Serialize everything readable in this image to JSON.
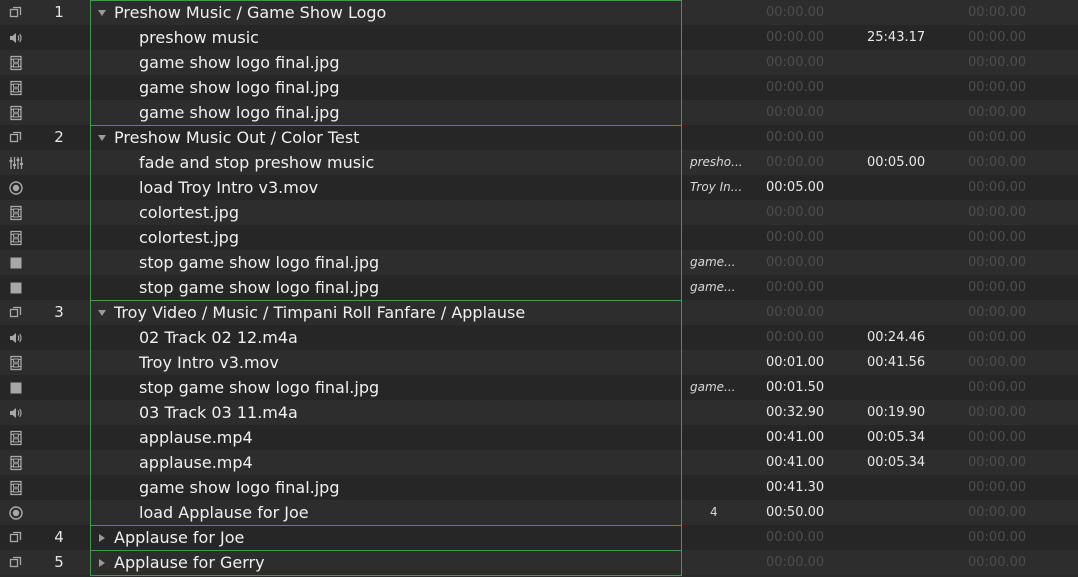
{
  "cues": [
    {
      "type": "group",
      "number": "1",
      "name": "Preshow Music / Game Show Logo",
      "target": "",
      "pre_wait": "00:00.00",
      "action": "",
      "post_wait": "00:00.00",
      "expanded": true,
      "depth": 0,
      "dims": {
        "pre": true,
        "post": true
      }
    },
    {
      "type": "audio",
      "number": "",
      "name": "preshow music",
      "target": "",
      "pre_wait": "00:00.00",
      "action": "25:43.17",
      "post_wait": "00:00.00",
      "depth": 1,
      "dims": {
        "pre": true,
        "post": true
      }
    },
    {
      "type": "video",
      "number": "",
      "name": "game show logo final.jpg",
      "target": "",
      "pre_wait": "00:00.00",
      "action": "",
      "post_wait": "00:00.00",
      "depth": 1,
      "dims": {
        "pre": true,
        "post": true
      }
    },
    {
      "type": "video",
      "number": "",
      "name": "game show logo final.jpg",
      "target": "",
      "pre_wait": "00:00.00",
      "action": "",
      "post_wait": "00:00.00",
      "depth": 1,
      "dims": {
        "pre": true,
        "post": true
      }
    },
    {
      "type": "video",
      "number": "",
      "name": "game show logo final.jpg",
      "target": "",
      "pre_wait": "00:00.00",
      "action": "",
      "post_wait": "00:00.00",
      "depth": 1,
      "dims": {
        "pre": true,
        "post": true
      }
    },
    {
      "type": "group",
      "number": "2",
      "name": "Preshow Music Out / Color Test",
      "target": "",
      "pre_wait": "00:00.00",
      "action": "",
      "post_wait": "00:00.00",
      "expanded": true,
      "depth": 0,
      "dims": {
        "pre": true,
        "post": true
      }
    },
    {
      "type": "fade",
      "number": "",
      "name": "fade and stop preshow music",
      "target": "presho...",
      "pre_wait": "00:00.00",
      "action": "00:05.00",
      "post_wait": "00:00.00",
      "depth": 1,
      "dims": {
        "pre": true,
        "post": true
      }
    },
    {
      "type": "load",
      "number": "",
      "name": "load Troy Intro v3.mov",
      "target": "Troy In...",
      "pre_wait": "00:05.00",
      "action": "",
      "post_wait": "00:00.00",
      "depth": 1,
      "dims": {
        "pre": false,
        "post": true
      }
    },
    {
      "type": "video",
      "number": "",
      "name": "colortest.jpg",
      "target": "",
      "pre_wait": "00:00.00",
      "action": "",
      "post_wait": "00:00.00",
      "depth": 1,
      "dims": {
        "pre": true,
        "post": true
      }
    },
    {
      "type": "video",
      "number": "",
      "name": "colortest.jpg",
      "target": "",
      "pre_wait": "00:00.00",
      "action": "",
      "post_wait": "00:00.00",
      "depth": 1,
      "dims": {
        "pre": true,
        "post": true
      }
    },
    {
      "type": "stop",
      "number": "",
      "name": "stop game show logo final.jpg",
      "target": "game...",
      "pre_wait": "00:00.00",
      "action": "",
      "post_wait": "00:00.00",
      "depth": 1,
      "dims": {
        "pre": true,
        "post": true
      }
    },
    {
      "type": "stop",
      "number": "",
      "name": "stop game show logo final.jpg",
      "target": "game...",
      "pre_wait": "00:00.00",
      "action": "",
      "post_wait": "00:00.00",
      "depth": 1,
      "dims": {
        "pre": true,
        "post": true
      }
    },
    {
      "type": "group",
      "number": "3",
      "name": "Troy Video / Music / Timpani Roll Fanfare / Applause",
      "target": "",
      "pre_wait": "00:00.00",
      "action": "",
      "post_wait": "00:00.00",
      "expanded": true,
      "depth": 0,
      "dims": {
        "pre": true,
        "post": true
      }
    },
    {
      "type": "audio",
      "number": "",
      "name": "02 Track 02 12.m4a",
      "target": "",
      "pre_wait": "00:00.00",
      "action": "00:24.46",
      "post_wait": "00:00.00",
      "depth": 1,
      "dims": {
        "pre": true,
        "post": true
      }
    },
    {
      "type": "video",
      "number": "",
      "name": "Troy Intro v3.mov",
      "target": "",
      "pre_wait": "00:01.00",
      "action": "00:41.56",
      "post_wait": "00:00.00",
      "depth": 1,
      "dims": {
        "pre": false,
        "post": true
      }
    },
    {
      "type": "stop",
      "number": "",
      "name": "stop game show logo final.jpg",
      "target": "game...",
      "pre_wait": "00:01.50",
      "action": "",
      "post_wait": "00:00.00",
      "depth": 1,
      "dims": {
        "pre": false,
        "post": true
      }
    },
    {
      "type": "audio",
      "number": "",
      "name": "03 Track 03 11.m4a",
      "target": "",
      "pre_wait": "00:32.90",
      "action": "00:19.90",
      "post_wait": "00:00.00",
      "depth": 1,
      "dims": {
        "pre": false,
        "post": true
      }
    },
    {
      "type": "video",
      "number": "",
      "name": "applause.mp4",
      "target": "",
      "pre_wait": "00:41.00",
      "action": "00:05.34",
      "post_wait": "00:00.00",
      "depth": 1,
      "dims": {
        "pre": false,
        "post": true
      }
    },
    {
      "type": "video",
      "number": "",
      "name": "applause.mp4",
      "target": "",
      "pre_wait": "00:41.00",
      "action": "00:05.34",
      "post_wait": "00:00.00",
      "depth": 1,
      "dims": {
        "pre": false,
        "post": true
      }
    },
    {
      "type": "video",
      "number": "",
      "name": "game show logo final.jpg",
      "target": "",
      "pre_wait": "00:41.30",
      "action": "",
      "post_wait": "00:00.00",
      "depth": 1,
      "dims": {
        "pre": false,
        "post": true
      }
    },
    {
      "type": "load",
      "number": "",
      "name": "load Applause for Joe",
      "target": "4",
      "pre_wait": "00:50.00",
      "action": "",
      "post_wait": "00:00.00",
      "depth": 1,
      "target_plain": true,
      "dims": {
        "pre": false,
        "post": true
      }
    },
    {
      "type": "group",
      "number": "4",
      "name": "Applause for Joe",
      "target": "",
      "pre_wait": "00:00.00",
      "action": "",
      "post_wait": "00:00.00",
      "expanded": false,
      "depth": 0,
      "dims": {
        "pre": true,
        "post": true
      }
    },
    {
      "type": "group",
      "number": "5",
      "name": "Applause for Gerry",
      "target": "",
      "pre_wait": "00:00.00",
      "action": "",
      "post_wait": "00:00.00",
      "expanded": false,
      "depth": 0,
      "dims": {
        "pre": true,
        "post": true
      }
    }
  ],
  "icons": {
    "group": "group-cue-icon",
    "audio": "speaker-icon",
    "video": "film-icon",
    "fade": "sliders-icon",
    "load": "target-icon",
    "stop": "stop-square-icon"
  },
  "colors": {
    "group_border": "#3f9a4a",
    "row_odd": "#2d2d2d",
    "row_even": "#262626",
    "dim_text": "#4d4d4d",
    "text": "#e8e8e8"
  }
}
